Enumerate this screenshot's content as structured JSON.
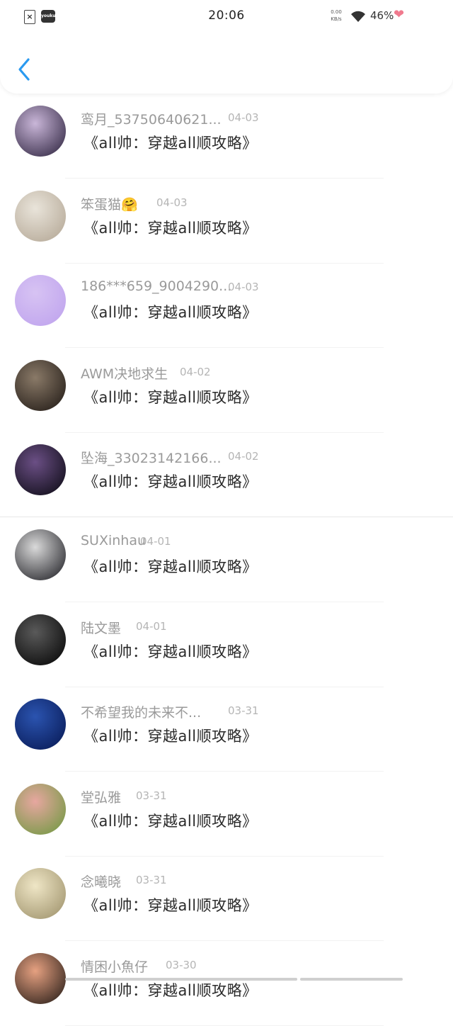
{
  "status_bar": {
    "time": "20:06",
    "net_speed_value": "0.00",
    "net_speed_unit": "KB/s",
    "battery": "46%"
  },
  "comments": [
    {
      "name": "鸾月_53750640621...",
      "date": "04-03",
      "title": "《all帅：穿越all顺攻略》",
      "avatar_colors": [
        "#c9b6d8",
        "#3f3450"
      ]
    },
    {
      "name": "笨蛋猫🤗",
      "date": "04-03",
      "title": "《all帅：穿越all顺攻略》",
      "avatar_colors": [
        "#e9e4da",
        "#b9ad9c"
      ]
    },
    {
      "name": "186***659_9004290...",
      "date": "04-03",
      "title": "《all帅：穿越all顺攻略》",
      "avatar_colors": [
        "#d7c3f3",
        "#c1a6ee"
      ]
    },
    {
      "name": "AWM决地求生",
      "date": "04-02",
      "title": "《all帅：穿越all顺攻略》",
      "avatar_colors": [
        "#8a7a68",
        "#2c241e"
      ]
    },
    {
      "name": "坠海_33023142166...",
      "date": "04-02",
      "title": "《all帅：穿越all顺攻略》",
      "avatar_colors": [
        "#6b4f85",
        "#161220"
      ]
    },
    {
      "name": "SUXinhau",
      "date": "04-01",
      "title": "《all帅：穿越all顺攻略》",
      "avatar_colors": [
        "#dadada",
        "#333338"
      ]
    },
    {
      "name": "陆文墨",
      "date": "04-01",
      "title": "《all帅：穿越all顺攻略》",
      "avatar_colors": [
        "#5a5a5a",
        "#0e0e0e"
      ]
    },
    {
      "name": "不希望我的未来不...",
      "date": "03-31",
      "title": "《all帅：穿越all顺攻略》",
      "avatar_colors": [
        "#2b54b0",
        "#0b1f5e"
      ]
    },
    {
      "name": "堂弘雅",
      "date": "03-31",
      "title": "《all帅：穿越all顺攻略》",
      "avatar_colors": [
        "#e7a7a0",
        "#7b9a4a"
      ]
    },
    {
      "name": "念曦晓",
      "date": "03-31",
      "title": "《all帅：穿越all顺攻略》",
      "avatar_colors": [
        "#efe6c6",
        "#a69a74"
      ]
    },
    {
      "name": "情困小魚仔",
      "date": "03-30",
      "title": "《all帅：穿越all顺攻略》",
      "avatar_colors": [
        "#e6a181",
        "#3a2a22"
      ]
    }
  ],
  "icons": {
    "back": "chevron-left-icon",
    "wifi": "wifi-icon",
    "heart": "heart-icon"
  },
  "colors": {
    "accent": "#2a9af0"
  }
}
